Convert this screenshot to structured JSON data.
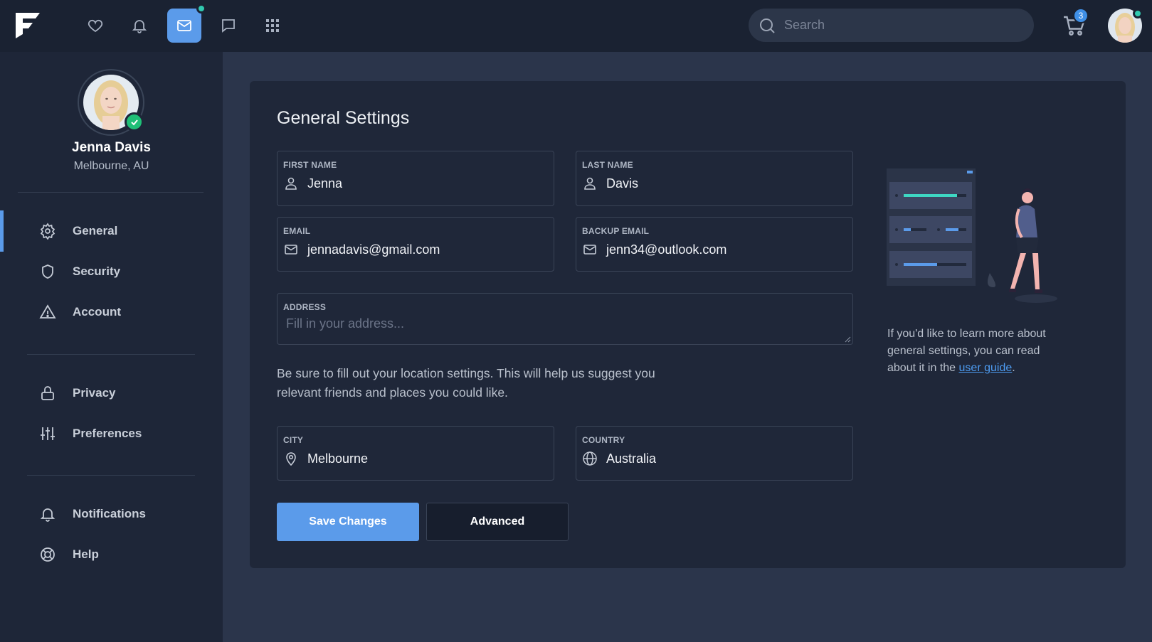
{
  "topbar": {
    "search_placeholder": "Search",
    "cart_count": "3",
    "icons": [
      "logo-icon",
      "heart-icon",
      "bell-icon",
      "mail-icon",
      "chat-icon",
      "grid-icon",
      "cart-icon"
    ]
  },
  "profile": {
    "name": "Jenna Davis",
    "location": "Melbourne, AU"
  },
  "sidebar": {
    "items": [
      {
        "label": "General",
        "icon": "gear-icon"
      },
      {
        "label": "Security",
        "icon": "shield-icon"
      },
      {
        "label": "Account",
        "icon": "warning-icon"
      },
      {
        "label": "Privacy",
        "icon": "lock-icon"
      },
      {
        "label": "Preferences",
        "icon": "sliders-icon"
      },
      {
        "label": "Notifications",
        "icon": "bell-icon"
      },
      {
        "label": "Help",
        "icon": "lifebuoy-icon"
      }
    ]
  },
  "main": {
    "title": "General Settings",
    "first_name": {
      "label": "FIRST NAME",
      "value": "Jenna"
    },
    "last_name": {
      "label": "LAST NAME",
      "value": "Davis"
    },
    "email": {
      "label": "EMAIL",
      "value": "jennadavis@gmail.com"
    },
    "backup_email": {
      "label": "BACKUP EMAIL",
      "value": "jenn34@outlook.com"
    },
    "address": {
      "label": "ADDRESS",
      "placeholder": "Fill in your address..."
    },
    "help_text": "Be sure to fill out your location settings. This will help us suggest you relevant friends and places you could like.",
    "city": {
      "label": "CITY",
      "value": "Melbourne"
    },
    "country": {
      "label": "COUNTRY",
      "value": "Australia"
    },
    "save_label": "Save Changes",
    "advanced_label": "Advanced",
    "info_text_before": "If you'd like to learn more about general settings, you can read about it in the ",
    "info_link": "user guide",
    "info_text_after": "."
  },
  "colors": {
    "accent": "#5b9bea",
    "topbar_bg": "#1a2232",
    "sidebar_bg": "#1e2638",
    "page_bg": "#2b354b",
    "card_bg": "#1f2739",
    "online": "#31c9b0",
    "verified": "#1fbf77"
  }
}
